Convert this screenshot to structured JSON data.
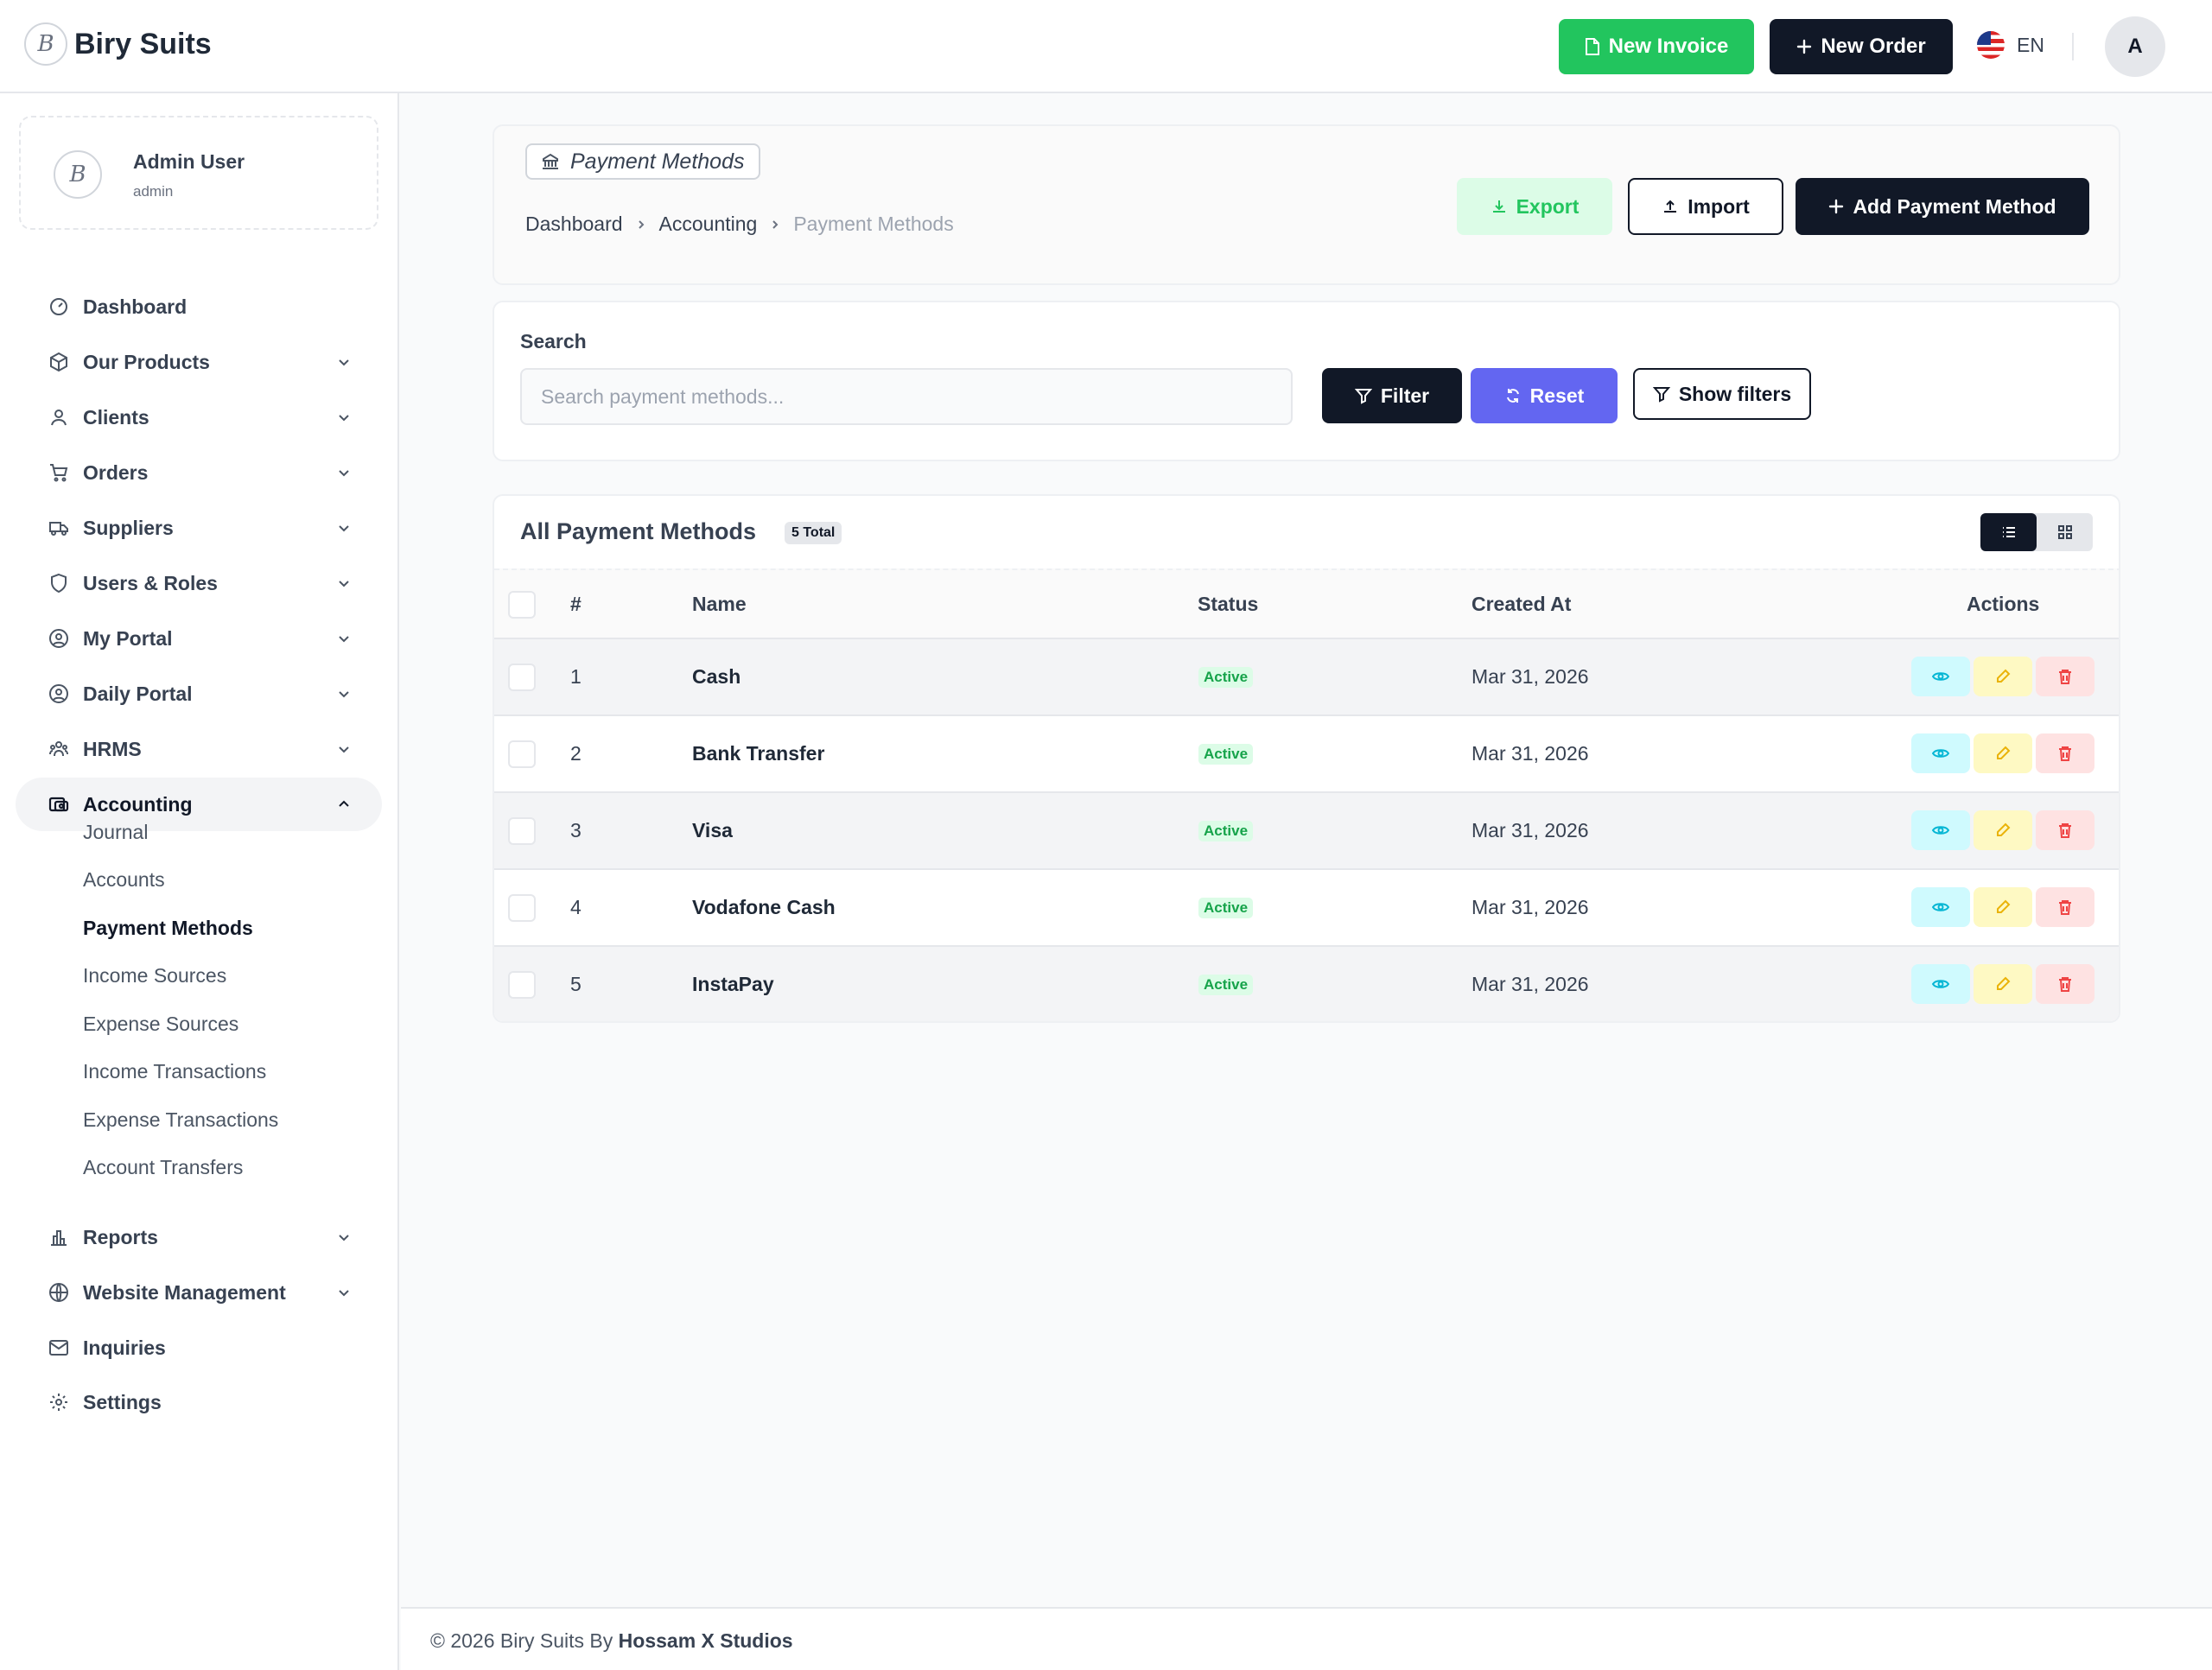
{
  "app": {
    "brand": "Biry Suits",
    "logo_letter": "B"
  },
  "topbar": {
    "new_invoice": "New Invoice",
    "new_order": "New Order",
    "language": "EN",
    "avatar": "A"
  },
  "user": {
    "name": "Admin User",
    "role": "admin"
  },
  "sidebar": {
    "items": [
      {
        "label": "Dashboard",
        "icon": "gauge-icon"
      },
      {
        "label": "Our Products",
        "icon": "box-icon"
      },
      {
        "label": "Clients",
        "icon": "user-icon"
      },
      {
        "label": "Orders",
        "icon": "cart-icon"
      },
      {
        "label": "Suppliers",
        "icon": "truck-icon"
      },
      {
        "label": "Users & Roles",
        "icon": "shield-icon"
      },
      {
        "label": "My Portal",
        "icon": "user-circle-icon"
      },
      {
        "label": "Daily Portal",
        "icon": "user-circle-icon"
      },
      {
        "label": "HRMS",
        "icon": "users-icon"
      },
      {
        "label": "Accounting",
        "icon": "wallet-icon"
      },
      {
        "label": "Reports",
        "icon": "bar-chart-icon"
      },
      {
        "label": "Website Management",
        "icon": "globe-icon"
      },
      {
        "label": "Inquiries",
        "icon": "mail-icon"
      },
      {
        "label": "Settings",
        "icon": "gear-icon"
      }
    ],
    "accounting_sub": [
      "Journal",
      "Accounts",
      "Payment Methods",
      "Income Sources",
      "Expense Sources",
      "Income Transactions",
      "Expense Transactions",
      "Account Transfers"
    ]
  },
  "page": {
    "chip": "Payment Methods",
    "breadcrumb": [
      "Dashboard",
      "Accounting",
      "Payment Methods"
    ],
    "export": "Export",
    "import": "Import",
    "add": "Add Payment Method"
  },
  "search": {
    "label": "Search",
    "placeholder": "Search payment methods...",
    "filter": "Filter",
    "reset": "Reset",
    "show_filters": "Show filters"
  },
  "table": {
    "title": "All Payment Methods",
    "badge": "5 Total",
    "headers": [
      "#",
      "Name",
      "Status",
      "Created At",
      "Actions"
    ],
    "rows": [
      {
        "id": "1",
        "name": "Cash",
        "status": "Active",
        "created": "Mar 31, 2026"
      },
      {
        "id": "2",
        "name": "Bank Transfer",
        "status": "Active",
        "created": "Mar 31, 2026"
      },
      {
        "id": "3",
        "name": "Visa",
        "status": "Active",
        "created": "Mar 31, 2026"
      },
      {
        "id": "4",
        "name": "Vodafone Cash",
        "status": "Active",
        "created": "Mar 31, 2026"
      },
      {
        "id": "5",
        "name": "InstaPay",
        "status": "Active",
        "created": "Mar 31, 2026"
      }
    ]
  },
  "footer": {
    "text": "© 2026 Biry Suits By",
    "studio": "Hossam X Studios"
  },
  "colors": {
    "success": "#22c55e",
    "dark": "#111827",
    "indigo": "#6366f1"
  }
}
